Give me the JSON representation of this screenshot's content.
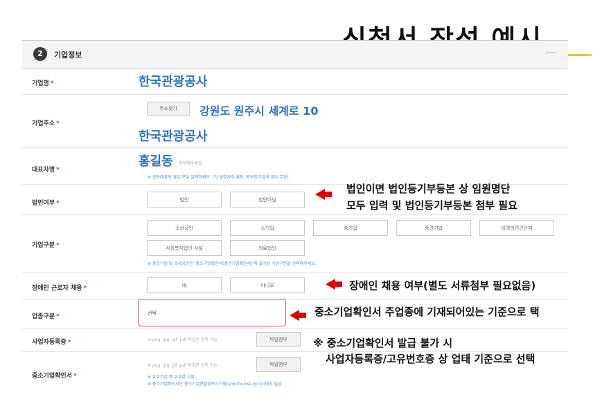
{
  "slide_title": "신청서 작성 예시",
  "section": {
    "number": "2",
    "title": "기업정보"
  },
  "labels": {
    "company_name": "기업명",
    "company_address": "기업주소",
    "representative": "대표자명",
    "corporation": "법인여부",
    "company_type": "기업구분",
    "disabled_hire": "장애인 근로자 채용",
    "industry": "업종구분",
    "business_reg": "사업자등록증",
    "sme_cert": "중소기업확인서"
  },
  "required_mark": "*",
  "values": {
    "company_name": "한국관광공사",
    "address_line1": "강원도 원주시 세계로 10",
    "address_line2": "한국관광공사",
    "representative": "홍길동",
    "representative_placeholder_tail": "입력해주세요.",
    "industry_select": "선택"
  },
  "buttons": {
    "address_search": "주소찾기",
    "corp_yes": "법인",
    "corp_no": "법인아님",
    "type_1": "소상공인",
    "type_2": "소기업",
    "type_3": "중기업",
    "type_4": "중견기업",
    "type_5": "비영리민간단체",
    "type_6": "사회복지법인·시설",
    "type_7": "의료법인",
    "hire_yes": "예",
    "hire_no": "아니오",
    "attach_1": "파일첨부",
    "attach_2": "파일첨부"
  },
  "hints": {
    "representative": "※ 공동대표의 경우 모두 입력하세요. (각 성명사이 쉼표, 외국인기업의 경우 무방)",
    "company_type": "※ 중소기업 및 소상공인은 '중소기업확인서(중견기업확인서)'에 표기된 기업구분을 선택해주세요.",
    "attach_note": "※ png, jpg, gif, pdf 파일만 등록 가능",
    "sme_line1": "※ 유효기간 중 유효한 서류",
    "sme_line2": "※ 중소기업확인서는 중소기업현황정보시스템(sminfo.mss.go.kr)에서 발급"
  },
  "annotations": {
    "corp_line1": "법인이면 법인등기부등본 상 임원명단",
    "corp_line2": "모두 입력 및 법인등기부등본 첨부 필요",
    "hire": "장애인 채용 여부(별도 서류첨부 필요없음)",
    "industry": "중소기업확인서 주업종에 기재되어있는 기준으로 택",
    "note_line1": "※ 중소기업확인서 발급 불가 시",
    "note_line2": "사업자등록증/고유번호증 상 업태 기준으로 선택"
  },
  "colors": {
    "accent_blue": "#2e72b8",
    "arrow_red": "#e00000",
    "title_rule": "#f2c230"
  },
  "icons": {
    "arrows": "red-left-arrow-icon"
  }
}
